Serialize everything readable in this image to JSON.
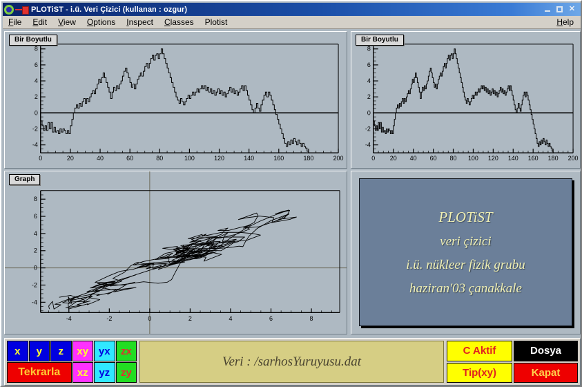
{
  "window": {
    "title": "PLOTiST - i.ü. Veri Çizici (kullanan : ozgur)",
    "app_icon": "plotist-app-icon",
    "pin_icon": "pushpin-icon",
    "minimize_label": "",
    "maximize_label": "",
    "close_label": "✕"
  },
  "menubar": {
    "items": [
      {
        "label": "File",
        "mnemonic": "F"
      },
      {
        "label": "Edit",
        "mnemonic": "E"
      },
      {
        "label": "View",
        "mnemonic": "V"
      },
      {
        "label": "Options",
        "mnemonic": "O"
      },
      {
        "label": "Inspect",
        "mnemonic": "I"
      },
      {
        "label": "Classes",
        "mnemonic": "C"
      },
      {
        "label": "Plotist",
        "mnemonic": ""
      }
    ],
    "help_label": "Help",
    "help_mnemonic": "H"
  },
  "panels": {
    "top_left": {
      "tab": "Bir Boyutlu"
    },
    "top_right": {
      "tab": "Bir Boyutlu"
    },
    "graph": {
      "tab": "Graph"
    }
  },
  "info_panel": {
    "line1": "PLOTiST",
    "line2": "veri çizici",
    "line3": "i.ü. nükleer fizik grubu",
    "line4": "haziran'03 çanakkale",
    "background_color": "#6b7f99",
    "text_color": "#f0f0b4"
  },
  "toolbar": {
    "axis_buttons": [
      {
        "label": "x",
        "color": "blue"
      },
      {
        "label": "y",
        "color": "blue"
      },
      {
        "label": "z",
        "color": "blue"
      },
      {
        "label": "xy",
        "color": "magenta"
      },
      {
        "label": "yx",
        "color": "cyan"
      },
      {
        "label": "zx",
        "color": "green"
      },
      {
        "label": "Tekrarla",
        "color": "red"
      },
      {
        "label": "xz",
        "color": "magenta"
      },
      {
        "label": "yz",
        "color": "cyan"
      },
      {
        "label": "zy",
        "color": "green"
      }
    ],
    "veri_label": "Veri : /sarhosYuruyusu.dat",
    "right_buttons": [
      {
        "label": "C Aktif",
        "color": "yellow"
      },
      {
        "label": "Dosya",
        "color": "black"
      },
      {
        "label": "Tip(xy)",
        "color": "yellow"
      },
      {
        "label": "Kapat",
        "color": "red"
      }
    ]
  },
  "chart_data": [
    {
      "id": "top_left",
      "type": "line",
      "title": "Bir Boyutlu",
      "xlabel": "",
      "ylabel": "",
      "xlim": [
        0,
        200
      ],
      "ylim": [
        -5,
        8.6
      ],
      "xticks": [
        0,
        20,
        40,
        60,
        80,
        100,
        120,
        140,
        160,
        180,
        200
      ],
      "yticks": [
        -4,
        -2,
        0,
        2,
        4,
        6,
        8
      ],
      "grid": false,
      "zero_line": true,
      "series": [
        {
          "name": "sarhos yuruyusu",
          "x_step": 1,
          "values": [
            -1.0,
            -1.6,
            -2.2,
            -1.6,
            -2.2,
            -1.2,
            -2.0,
            -1.2,
            -2.4,
            -1.8,
            -2.4,
            -2.2,
            -2.6,
            -2.0,
            -2.4,
            -2.0,
            -2.2,
            -2.6,
            -2.2,
            -2.6,
            -1.6,
            -0.8,
            0.0,
            0.6,
            1.0,
            0.6,
            1.2,
            0.8,
            1.4,
            1.8,
            1.2,
            1.8,
            1.4,
            2.0,
            2.4,
            2.8,
            2.4,
            3.0,
            3.6,
            4.2,
            3.8,
            4.4,
            5.0,
            4.4,
            3.8,
            3.2,
            2.6,
            1.8,
            2.6,
            3.2,
            2.8,
            3.4,
            3.0,
            3.6,
            4.0,
            4.6,
            5.2,
            5.6,
            5.0,
            4.4,
            3.8,
            3.2,
            3.6,
            3.0,
            3.6,
            4.2,
            4.6,
            5.0,
            4.6,
            5.2,
            5.8,
            6.2,
            5.6,
            6.2,
            6.8,
            7.2,
            6.6,
            7.2,
            7.4,
            6.8,
            7.4,
            8.0,
            7.4,
            6.8,
            6.2,
            5.6,
            5.0,
            4.4,
            3.8,
            3.2,
            2.6,
            2.0,
            1.6,
            1.2,
            1.8,
            1.4,
            1.0,
            1.4,
            1.8,
            2.2,
            1.8,
            2.2,
            2.6,
            2.2,
            2.6,
            3.0,
            2.6,
            3.0,
            3.4,
            3.0,
            3.4,
            2.8,
            3.2,
            2.6,
            3.0,
            2.4,
            2.8,
            2.2,
            2.6,
            3.0,
            2.4,
            2.8,
            2.2,
            2.6,
            2.0,
            2.4,
            2.8,
            3.2,
            2.6,
            3.0,
            2.4,
            2.8,
            2.2,
            2.6,
            3.0,
            3.4,
            2.8,
            3.4,
            2.8,
            2.2,
            1.6,
            1.0,
            0.4,
            0.0,
            0.6,
            1.2,
            0.6,
            0.2,
            1.0,
            1.6,
            2.2,
            2.6,
            2.0,
            2.6,
            2.2,
            1.6,
            1.0,
            0.4,
            -0.2,
            -0.8,
            -1.4,
            -2.0,
            -2.6,
            -3.2,
            -3.8,
            -4.2,
            -3.6,
            -4.0,
            -3.4,
            -3.8,
            -3.2,
            -3.6,
            -4.0,
            -3.4,
            -3.8,
            -4.2,
            -3.8,
            -4.2,
            -4.4,
            -4.8,
            -5.0
          ]
        }
      ]
    },
    {
      "id": "top_right",
      "type": "line",
      "title": "Bir Boyutlu",
      "xlabel": "",
      "ylabel": "",
      "xlim": [
        0,
        200
      ],
      "ylim": [
        -5,
        8.6
      ],
      "xticks": [
        0,
        20,
        40,
        60,
        80,
        100,
        120,
        140,
        160,
        180,
        200
      ],
      "yticks": [
        -4,
        -2,
        0,
        2,
        4,
        6,
        8
      ],
      "grid": false,
      "zero_line": true,
      "note": "same series as top_left, horizontally compressed"
    },
    {
      "id": "graph",
      "type": "scatter",
      "title": "Graph",
      "xlabel": "",
      "ylabel": "",
      "xlim": [
        -5.4,
        9.4
      ],
      "ylim": [
        -5.2,
        9.0
      ],
      "xticks": [
        -4,
        -2,
        0,
        2,
        4,
        6,
        8
      ],
      "yticks": [
        -4,
        -2,
        0,
        2,
        4,
        6,
        8
      ],
      "grid": false,
      "crosshair_at": [
        0,
        0
      ],
      "note": "2-D random-walk trajectory, diagonal cloud rising from (-5,-5) to (8,7.5)"
    }
  ]
}
